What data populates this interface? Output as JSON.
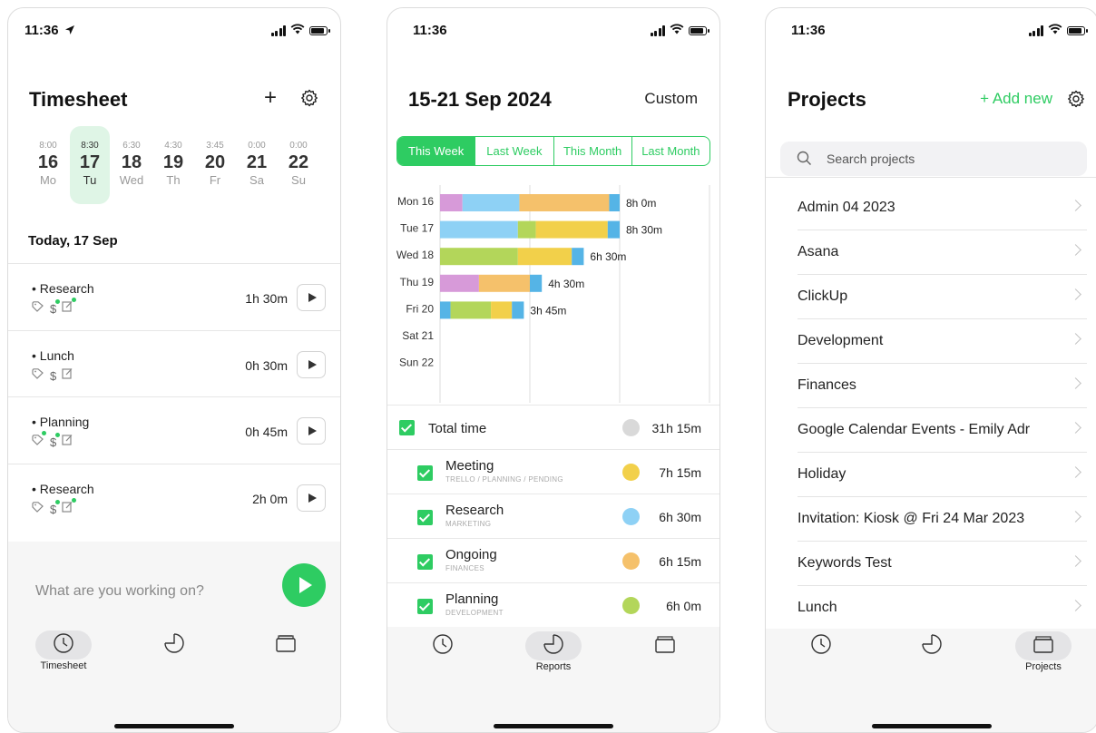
{
  "status_times": [
    "11:36",
    "11:36",
    "11:36"
  ],
  "timesheet": {
    "title": "Timesheet",
    "add_label": "+",
    "days": [
      {
        "dur": "8:00",
        "num": "16",
        "wd": "Mo",
        "selected": false
      },
      {
        "dur": "8:30",
        "num": "17",
        "wd": "Tu",
        "selected": true
      },
      {
        "dur": "6:30",
        "num": "18",
        "wd": "Wed",
        "selected": false
      },
      {
        "dur": "4:30",
        "num": "19",
        "wd": "Th",
        "selected": false
      },
      {
        "dur": "3:45",
        "num": "20",
        "wd": "Fr",
        "selected": false
      },
      {
        "dur": "0:00",
        "num": "21",
        "wd": "Sa",
        "selected": false
      },
      {
        "dur": "0:00",
        "num": "22",
        "wd": "Su",
        "selected": false
      }
    ],
    "section": "Today, 17 Sep",
    "entries": [
      {
        "name": "• Research",
        "duration": "1h 30m"
      },
      {
        "name": "• Lunch",
        "duration": "0h 30m"
      },
      {
        "name": "• Planning",
        "duration": "0h 45m"
      },
      {
        "name": "• Research",
        "duration": "2h 0m"
      }
    ],
    "input_placeholder": "What are you working on?",
    "tab_label": "Timesheet"
  },
  "reports": {
    "title": "15-21 Sep 2024",
    "custom_label": "Custom",
    "segments": [
      {
        "label": "This Week",
        "active": true
      },
      {
        "label": "Last Week",
        "active": false
      },
      {
        "label": "This Month",
        "active": false
      },
      {
        "label": "Last Month",
        "active": false
      }
    ],
    "total_label": "Total time",
    "total_value": "31h 15m",
    "total_color": "#d9d9d9",
    "legend": [
      {
        "name": "Meeting",
        "sub": "TRELLO / PLANNING / PENDING",
        "value": "7h 15m",
        "color": "#f2d04a"
      },
      {
        "name": "Research",
        "sub": "MARKETING",
        "value": "6h 30m",
        "color": "#8ed1f5"
      },
      {
        "name": "Ongoing",
        "sub": "FINANCES",
        "value": "6h 15m",
        "color": "#f5c16b"
      },
      {
        "name": "Planning",
        "sub": "DEVELOPMENT",
        "value": "6h 0m",
        "color": "#b3d65a"
      }
    ],
    "tab_label": "Reports"
  },
  "chart_data": {
    "type": "bar",
    "orientation": "horizontal",
    "stacked": true,
    "categories": [
      "Mon 16",
      "Tue 17",
      "Wed 18",
      "Thu 19",
      "Fri 20",
      "Sat 21",
      "Sun 22"
    ],
    "data_labels": [
      "8h 0m",
      "8h 30m",
      "6h 30m",
      "4h 30m",
      "3h 45m",
      "",
      ""
    ],
    "unit": "hours",
    "xlim": [
      0,
      10
    ],
    "gridlines_x": [
      0,
      3,
      6,
      9
    ],
    "segments": [
      [
        {
          "v": 0.75,
          "color": "#d79ad9"
        },
        {
          "v": 1.9,
          "color": "#8ed1f5"
        },
        {
          "v": 3.0,
          "color": "#f5c16b"
        },
        {
          "v": 0.35,
          "color": "#55b4e6"
        }
      ],
      [
        {
          "v": 2.6,
          "color": "#8ed1f5"
        },
        {
          "v": 0.6,
          "color": "#b3d65a"
        },
        {
          "v": 2.4,
          "color": "#f2d04a"
        },
        {
          "v": 0.4,
          "color": "#55b4e6"
        }
      ],
      [
        {
          "v": 2.6,
          "color": "#b3d65a"
        },
        {
          "v": 1.8,
          "color": "#f2d04a"
        },
        {
          "v": 0.4,
          "color": "#55b4e6"
        }
      ],
      [
        {
          "v": 1.3,
          "color": "#d79ad9"
        },
        {
          "v": 1.7,
          "color": "#f5c16b"
        },
        {
          "v": 0.4,
          "color": "#55b4e6"
        }
      ],
      [
        {
          "v": 0.35,
          "color": "#55b4e6"
        },
        {
          "v": 1.35,
          "color": "#b3d65a"
        },
        {
          "v": 0.7,
          "color": "#f2d04a"
        },
        {
          "v": 0.4,
          "color": "#55b4e6"
        }
      ],
      [],
      []
    ]
  },
  "projects": {
    "title": "Projects",
    "add_label": "+ Add new",
    "search_placeholder": "Search projects",
    "items": [
      "Admin 04 2023",
      "Asana",
      "ClickUp",
      "Development",
      "Finances",
      "Google Calendar Events - Emily Adr",
      "Holiday",
      "Invitation: Kiosk @ Fri 24 Mar 2023",
      "Keywords Test",
      "Lunch"
    ],
    "tab_label": "Projects"
  },
  "colors": {
    "accent": "#2ecc62",
    "selected_day_bg": "#dff5e6"
  }
}
